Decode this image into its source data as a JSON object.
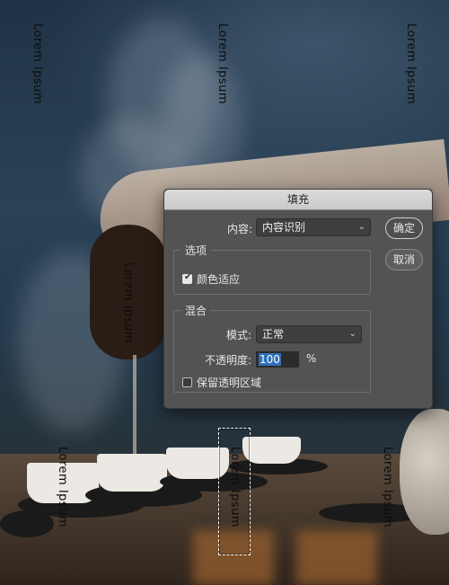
{
  "watermarks": [
    "Lorem Ipsum",
    "Lorem Ipsum",
    "Lorem Ipsum",
    "Lorem Ipsum",
    "Lorem Ipsum",
    "Lorem Ipsum",
    "Lorem Ipsum"
  ],
  "dialog": {
    "title": "填充",
    "content_label": "内容:",
    "content_value": "内容识别",
    "ok_label": "确定",
    "cancel_label": "取消",
    "options_group": "选项",
    "color_adapt_label": "颜色适应",
    "color_adapt_checked": true,
    "blend_group": "混合",
    "mode_label": "模式:",
    "mode_value": "正常",
    "opacity_label": "不透明度:",
    "opacity_value": "100",
    "opacity_unit": "%",
    "preserve_label": "保留透明区域",
    "preserve_checked": false
  },
  "icons": {
    "dropdown": "chevron-down-icon",
    "check": "checkmark-icon"
  }
}
